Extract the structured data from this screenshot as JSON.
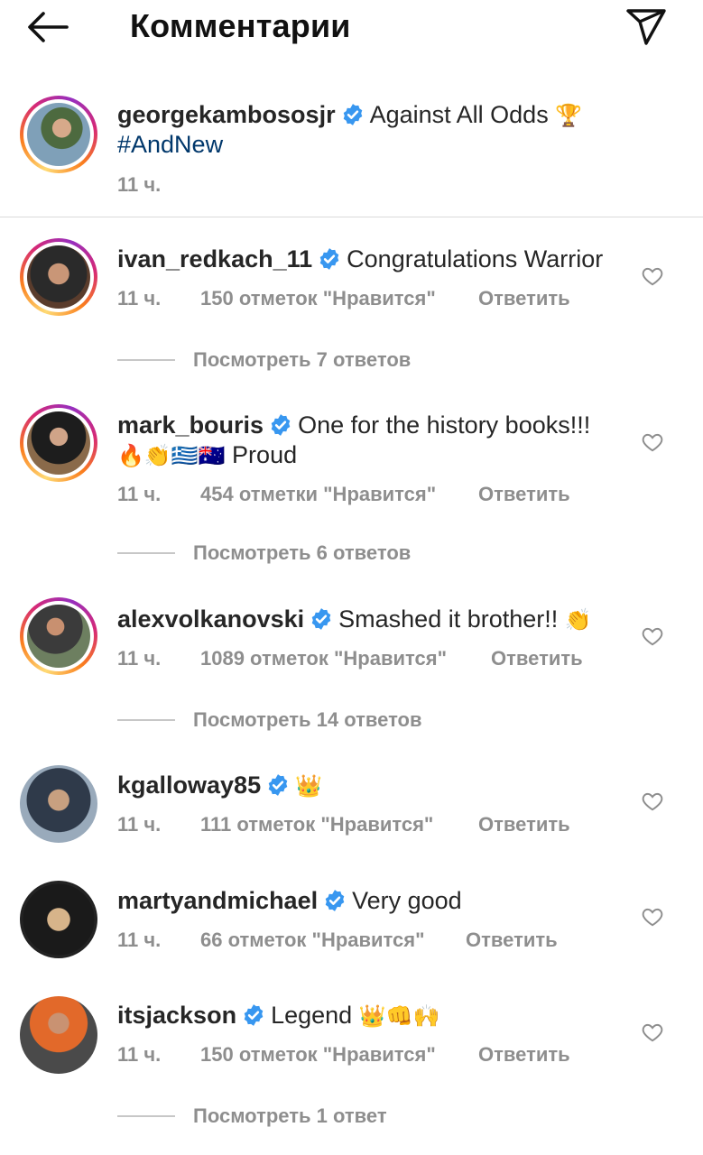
{
  "header": {
    "title": "Комментарии",
    "back_icon": "arrow-left-icon",
    "send_icon": "paper-plane-icon"
  },
  "caption": {
    "username": "georgekambososjr",
    "text": "Against All Odds",
    "emoji": "🏆",
    "hashtag": "#AndNew",
    "time": "11 ч."
  },
  "comments": [
    {
      "username": "ivan_redkach_11",
      "text": "Congratulations Warrior",
      "time": "11 ч.",
      "likes": "150 отметок \"Нравится\"",
      "reply": "Ответить",
      "view_replies": "Посмотреть 7 ответов"
    },
    {
      "username": "mark_bouris",
      "text": "One for the history books!!!",
      "text2": "Proud",
      "emoji2": "🔥👏🇬🇷🇦🇺",
      "time": "11 ч.",
      "likes": "454 отметки \"Нравится\"",
      "reply": "Ответить",
      "view_replies": "Посмотреть 6 ответов"
    },
    {
      "username": "alexvolkanovski",
      "text": "Smashed it brother!!",
      "emoji": "👏",
      "time": "11 ч.",
      "likes": "1089 отметок \"Нравится\"",
      "reply": "Ответить",
      "view_replies": "Посмотреть 14 ответов"
    },
    {
      "username": "kgalloway85",
      "text": "",
      "emoji": "👑",
      "time": "11 ч.",
      "likes": "111 отметок \"Нравится\"",
      "reply": "Ответить"
    },
    {
      "username": "martyandmichael",
      "text": "Very good",
      "time": "11 ч.",
      "likes": "66 отметок \"Нравится\"",
      "reply": "Ответить"
    },
    {
      "username": "itsjackson",
      "text": "Legend",
      "emoji": "👑👊🙌",
      "time": "11 ч.",
      "likes": "150 отметок \"Нравится\"",
      "reply": "Ответить",
      "view_replies": "Посмотреть 1 ответ"
    }
  ],
  "colors": {
    "verified": "#3897f0",
    "muted": "#8e8e8e",
    "hashtag": "#00376b",
    "text": "#262626"
  }
}
